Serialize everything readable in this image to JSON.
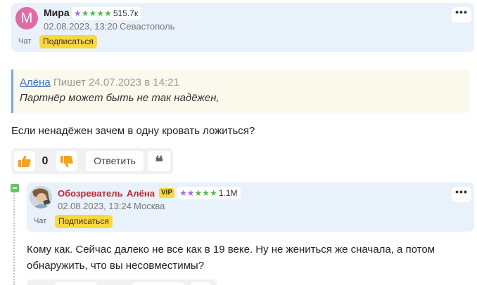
{
  "post1": {
    "avatar_letter": "M",
    "username": "Мира",
    "rating_stars": 5,
    "rating_value": "515.7к",
    "date": "02.08.2023, 13:20",
    "location": "Севастополь",
    "chat_label": "Чат",
    "subscribe_label": "Подписаться",
    "more_label": "•••"
  },
  "quote": {
    "author": "Алёна",
    "writes": "Пишет",
    "date": "24.07.2023 в 14:21",
    "text": "Партнёр может быть не так надёжен,"
  },
  "post1_body": "Если ненадёжен зачем в одну кровать ложиться?",
  "actions": {
    "likes_count": "0",
    "reply_label": "Ответить",
    "quote_label": "❝"
  },
  "post2": {
    "role": "Обозреватель",
    "username": "Алёна",
    "vip_label": "VIP",
    "rating_stars": 5,
    "rating_value": "1.1M",
    "date": "02.08.2023, 13:24",
    "location": "Москва",
    "chat_label": "Чат",
    "subscribe_label": "Подписаться",
    "more_label": "•••"
  },
  "post2_body_line1": "Кому как. Сейчас далеко не все как в 19 веке. Ну не жениться же сначала, а потом",
  "post2_body_line2": "обнаружить, что вы несовместимы?",
  "colors": {
    "card_bg": "#e9f1fb",
    "accent_yellow": "#ffd63c",
    "thumb_orange": "#f5a417",
    "star_purple": "#a56ae6",
    "star_green": "#4db84d",
    "link_blue": "#3a73c9",
    "role_red": "#c0272d",
    "avatar_pink": "#e06ca6"
  }
}
